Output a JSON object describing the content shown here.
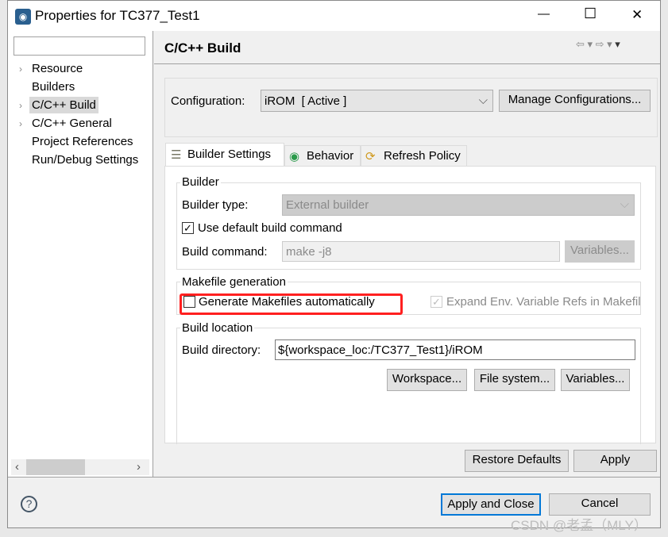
{
  "window": {
    "title": "Properties for TC377_Test1",
    "minimize": "—",
    "maximize": "☐",
    "close": "✕"
  },
  "sidebar": {
    "filter_placeholder": "",
    "items": [
      {
        "label": "Resource",
        "expandable": true
      },
      {
        "label": "Builders",
        "expandable": false
      },
      {
        "label": "C/C++ Build",
        "expandable": true,
        "selected": true
      },
      {
        "label": "C/C++ General",
        "expandable": true
      },
      {
        "label": "Project References",
        "expandable": false
      },
      {
        "label": "Run/Debug Settings",
        "expandable": false
      }
    ]
  },
  "page": {
    "title": "C/C++ Build",
    "configuration_label": "Configuration:",
    "configuration_value": "iROM  [ Active ]",
    "manage_button": "Manage Configurations...",
    "tabs": [
      {
        "label": "Builder Settings",
        "icon": "list-icon",
        "active": true
      },
      {
        "label": "Behavior",
        "icon": "radio-icon"
      },
      {
        "label": "Refresh Policy",
        "icon": "refresh-icon"
      }
    ],
    "builder": {
      "group": "Builder",
      "type_label": "Builder type:",
      "type_value": "External builder",
      "use_default_label": "Use default build command",
      "use_default_checked": true,
      "command_label": "Build command:",
      "command_value": "make -j8",
      "variables_button": "Variables..."
    },
    "makefile": {
      "group": "Makefile generation",
      "generate_label": "Generate Makefiles automatically",
      "generate_checked": false,
      "expand_label": "Expand Env. Variable Refs in Makefil",
      "expand_checked": true
    },
    "location": {
      "group": "Build location",
      "dir_label": "Build directory:",
      "dir_value": "${workspace_loc:/TC377_Test1}/iROM",
      "workspace_button": "Workspace...",
      "filesystem_button": "File system...",
      "variables_button": "Variables..."
    },
    "restore_button": "Restore Defaults",
    "apply_button": "Apply"
  },
  "footer": {
    "apply_close_button": "Apply and Close",
    "cancel_button": "Cancel",
    "help": "?"
  },
  "watermark": "CSDN @老孟（MLY）",
  "colors": {
    "highlight": "#ff2020",
    "focus": "#0078d7"
  }
}
